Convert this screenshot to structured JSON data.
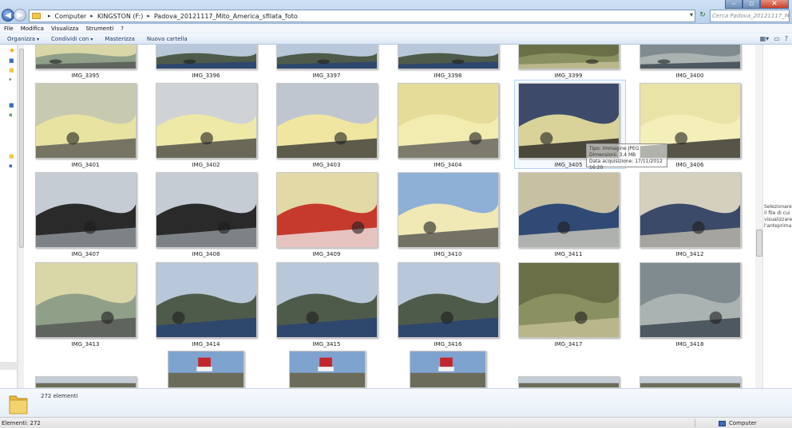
{
  "window": {
    "minimize_glyph": "–",
    "maximize_glyph": "▫",
    "close_glyph": "✕"
  },
  "address": {
    "crumbs": [
      "Computer",
      "KINGSTON (F:)",
      "Padova_20121117_Mito_America_sfilata_foto"
    ],
    "separator": "▸",
    "dropdown_glyph": "▾",
    "refresh_glyph": "↻"
  },
  "search": {
    "placeholder": "Cerca Padova_20121117_Mito..."
  },
  "menu": [
    "File",
    "Modifica",
    "Visualizza",
    "Strumenti",
    "?"
  ],
  "commands": {
    "organize": "Organizza",
    "share": "Condividi con",
    "burn": "Masterizza",
    "new_folder": "Nuova cartella",
    "caret": "▾"
  },
  "nav": {
    "back_glyph": "◀",
    "forward_glyph": "▶",
    "icons": [
      "star-icon",
      "folder-icon",
      "folder-icon",
      "download-icon",
      "computer-icon",
      "drive-icon",
      "folder-icon",
      "network-icon"
    ]
  },
  "files": [
    {
      "name": "IMG_3395"
    },
    {
      "name": "IMG_3396"
    },
    {
      "name": "IMG_3397"
    },
    {
      "name": "IMG_3398"
    },
    {
      "name": "IMG_3399"
    },
    {
      "name": "IMG_3400"
    },
    {
      "name": "IMG_3401"
    },
    {
      "name": "IMG_3402"
    },
    {
      "name": "IMG_3403"
    },
    {
      "name": "IMG_3404"
    },
    {
      "name": "IMG_3405"
    },
    {
      "name": "IMG_3406"
    },
    {
      "name": "IMG_3407"
    },
    {
      "name": "IMG_3408"
    },
    {
      "name": "IMG_3409"
    },
    {
      "name": "IMG_3410"
    },
    {
      "name": "IMG_3411"
    },
    {
      "name": "IMG_3412"
    },
    {
      "name": "IMG_3413"
    },
    {
      "name": "IMG_3414"
    },
    {
      "name": "IMG_3415"
    },
    {
      "name": "IMG_3416"
    },
    {
      "name": "IMG_3417"
    },
    {
      "name": "IMG_3418"
    }
  ],
  "tooltip": {
    "line1": "Tipo: Immagine JPEG",
    "line2": "Dimensioni: 3,4 MB",
    "line3": "Data acquisizione: 17/11/2012 16:20"
  },
  "preview_pane": {
    "message": "Selezionare il file di cui visualizzare l'anteprima."
  },
  "details": {
    "count_text": "272 elementi"
  },
  "status": {
    "items": "Elementi: 272",
    "location": "Computer"
  },
  "colors": {
    "accent": "#3c6db4",
    "folder": "#f0c84b",
    "selection": "#b6d3f1"
  }
}
